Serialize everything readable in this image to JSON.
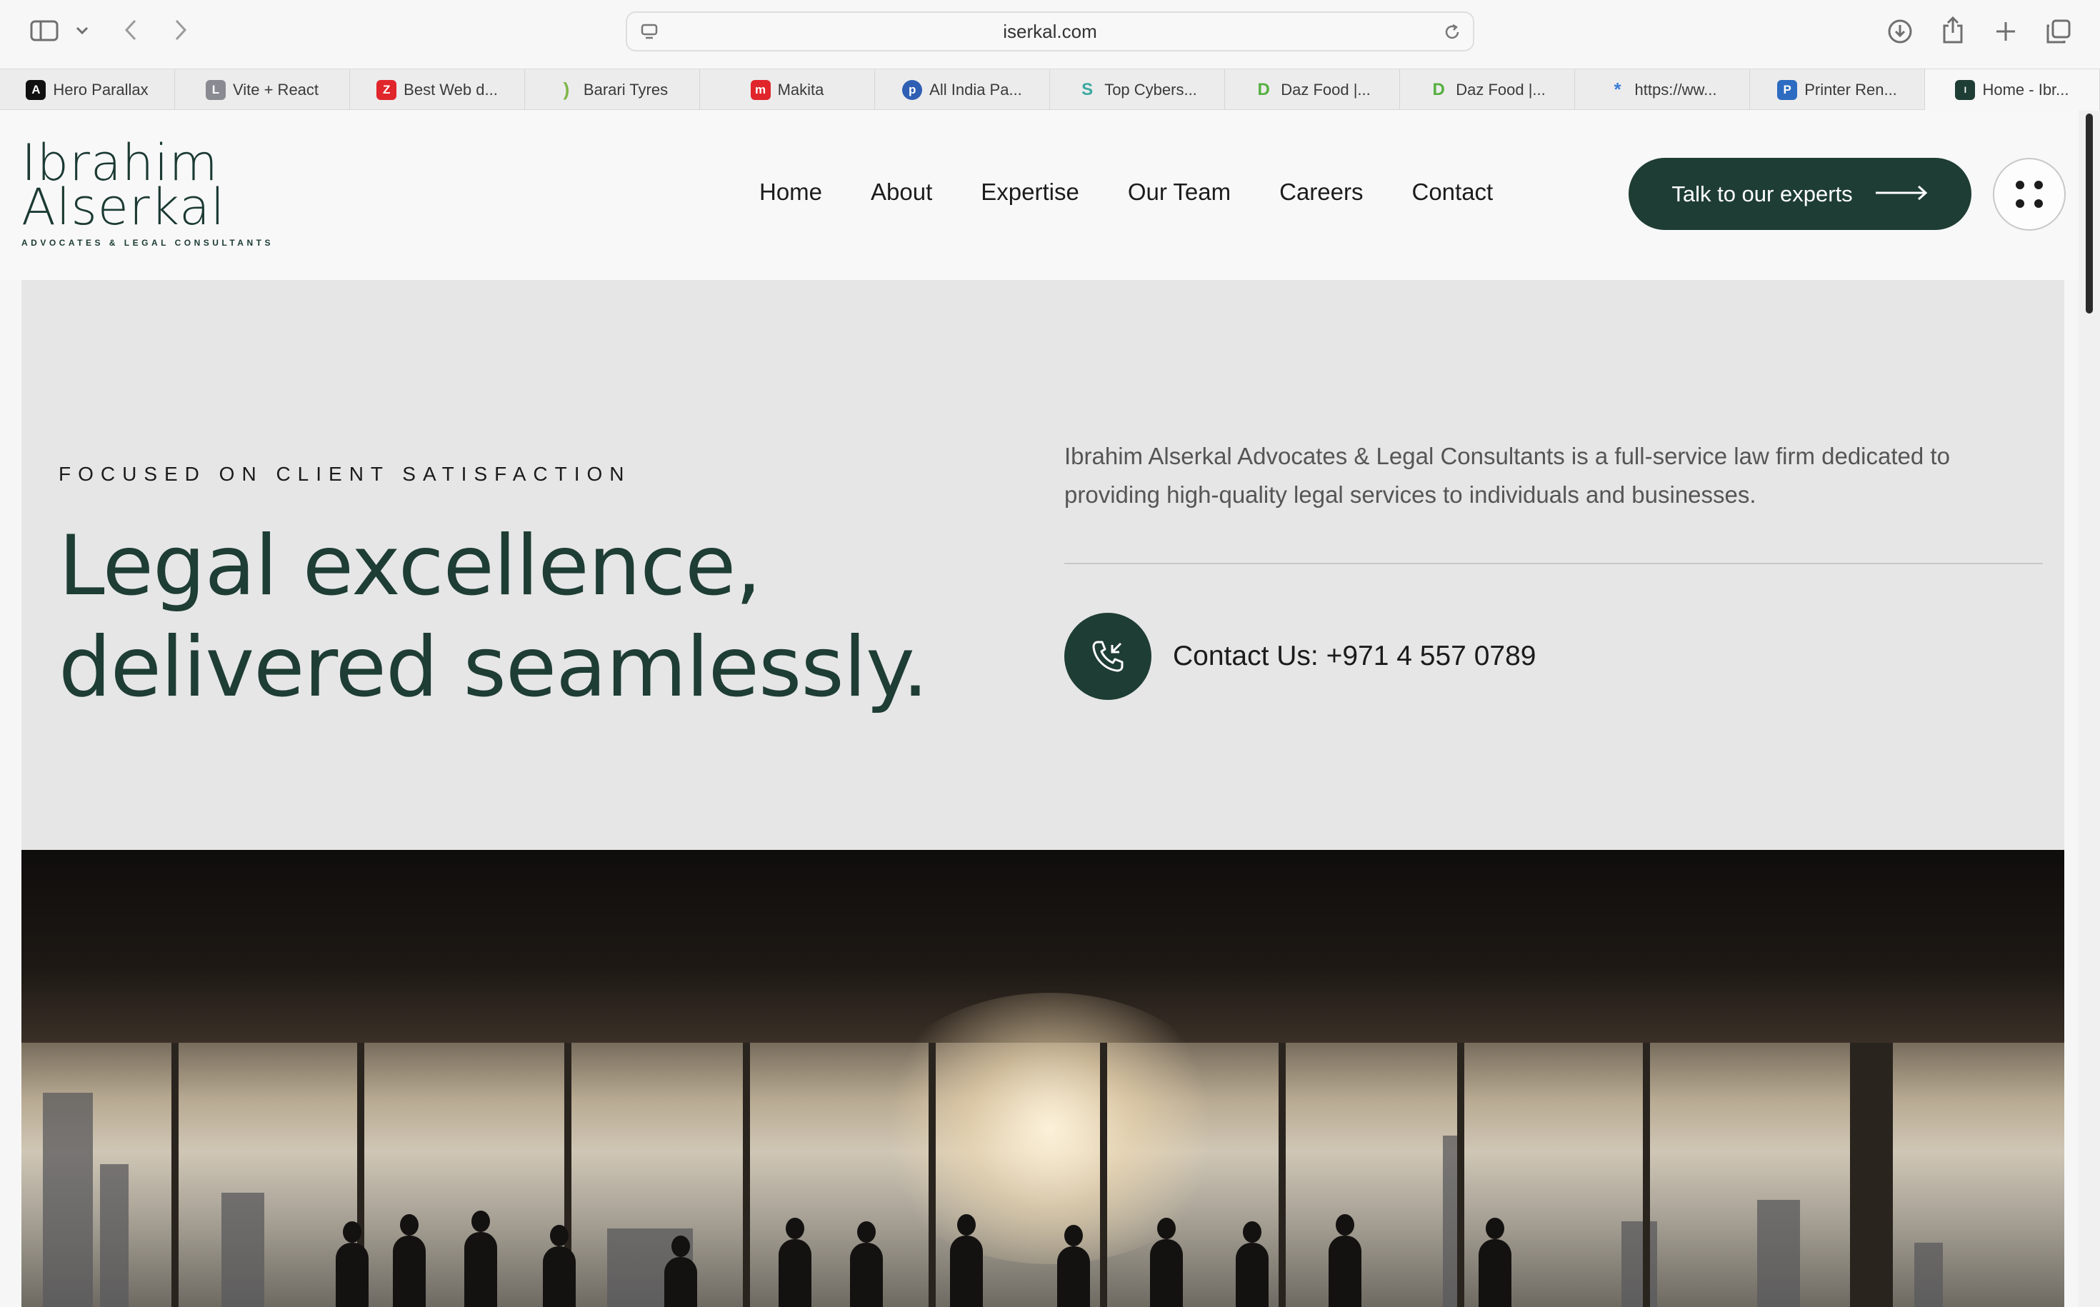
{
  "browser": {
    "url": "iserkal.com",
    "tabs": [
      {
        "title": "Hero Parallax",
        "icon": "hero-parallax-favicon",
        "color": "#111111",
        "glyph": "A"
      },
      {
        "title": "Vite + React",
        "icon": "vite-react-favicon",
        "color": "#8a8a92",
        "glyph": "L"
      },
      {
        "title": "Best Web d...",
        "icon": "best-web-favicon",
        "color": "#e0252b",
        "glyph": "Z"
      },
      {
        "title": "Barari Tyres",
        "icon": "barari-tyres-favicon",
        "color": "#7fb648",
        "glyph": ")"
      },
      {
        "title": "Makita",
        "icon": "makita-favicon",
        "color": "#e0252b",
        "glyph": "m"
      },
      {
        "title": "All India Pa...",
        "icon": "all-india-favicon",
        "color": "#2f5fb3",
        "glyph": "p"
      },
      {
        "title": "Top Cybers...",
        "icon": "top-cybers-favicon",
        "color": "#3aa9a0",
        "glyph": "S"
      },
      {
        "title": "Daz Food |...",
        "icon": "daz-food-favicon",
        "color": "#56b040",
        "glyph": "D"
      },
      {
        "title": "Daz Food |...",
        "icon": "daz-food-favicon",
        "color": "#56b040",
        "glyph": "D"
      },
      {
        "title": "https://ww...",
        "icon": "generic-site-favicon",
        "color": "#3b7fd9",
        "glyph": "*"
      },
      {
        "title": "Printer Ren...",
        "icon": "printer-favicon",
        "color": "#2d6cc0",
        "glyph": "P"
      },
      {
        "title": "Home - Ibr...",
        "icon": "iserkal-favicon",
        "color": "#1e3d34",
        "glyph": "I"
      }
    ],
    "active_tab_index": 11
  },
  "site": {
    "logo": {
      "line1": "Ibrahim",
      "line2": "Alserkal",
      "subtitle": "ADVOCATES & LEGAL CONSULTANTS"
    },
    "nav": [
      "Home",
      "About",
      "Expertise",
      "Our Team",
      "Careers",
      "Contact"
    ],
    "cta_label": "Talk to our experts",
    "hero": {
      "eyebrow": "FOCUSED ON CLIENT SATISFACTION",
      "headline_line1": "Legal excellence,",
      "headline_line2": "delivered seamlessly.",
      "intro": "Ibrahim Alserkal Advocates & Legal Consultants is a full-service law firm dedicated to providing high-quality legal services to individuals and businesses.",
      "contact": "Contact Us: +971 4 557 0789"
    }
  },
  "colors": {
    "brand": "#1e3d34",
    "hero_bg": "#e6e6e6"
  }
}
